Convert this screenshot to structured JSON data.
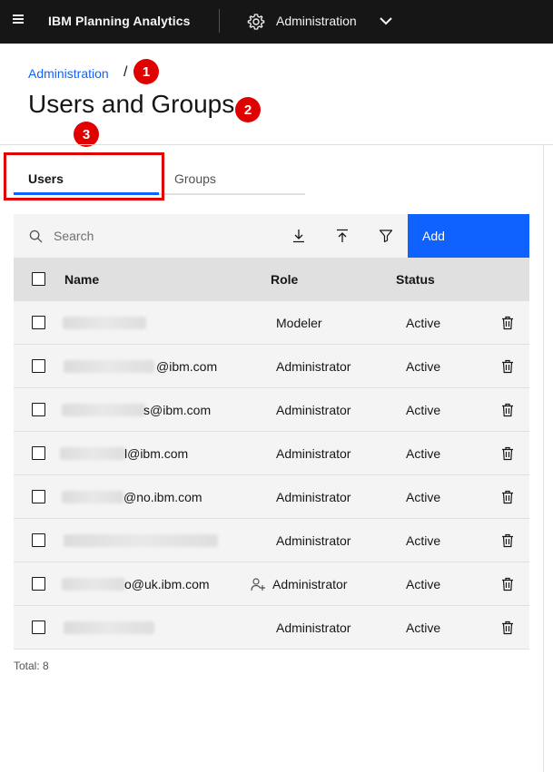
{
  "header": {
    "brand": "IBM Planning Analytics",
    "context_menu_label": "Administration"
  },
  "breadcrumb": {
    "items": [
      "Administration"
    ],
    "separator": "/"
  },
  "page_title": "Users and Groups",
  "annotations": [
    "1",
    "2",
    "3"
  ],
  "tabs": [
    {
      "label": "Users",
      "active": true
    },
    {
      "label": "Groups",
      "active": false
    }
  ],
  "toolbar": {
    "search_placeholder": "Search",
    "add_label": "Add",
    "icons": [
      "download-icon",
      "upload-icon",
      "filter-icon"
    ]
  },
  "table": {
    "columns": [
      "Name",
      "Role",
      "Status"
    ],
    "rows": [
      {
        "name": "",
        "role": "Modeler",
        "status": "Active"
      },
      {
        "name": "@ibm.com",
        "role": "Administrator",
        "status": "Active"
      },
      {
        "name": "s@ibm.com",
        "role": "Administrator",
        "status": "Active"
      },
      {
        "name": "l@ibm.com",
        "role": "Administrator",
        "status": "Active"
      },
      {
        "name": "@no.ibm.com",
        "role": "Administrator",
        "status": "Active"
      },
      {
        "name": "",
        "role": "Administrator",
        "status": "Active"
      },
      {
        "name": "o@uk.ibm.com",
        "role": "Administrator",
        "status": "Active"
      },
      {
        "name": "",
        "role": "Administrator",
        "status": "Active"
      }
    ],
    "total_label": "Total: 8"
  },
  "colors": {
    "header_bg": "#161616",
    "accent": "#0f62fe",
    "annotation": "#e00000",
    "toolbar_bg": "#f4f4f4",
    "table_header_bg": "#e0e0e0"
  }
}
